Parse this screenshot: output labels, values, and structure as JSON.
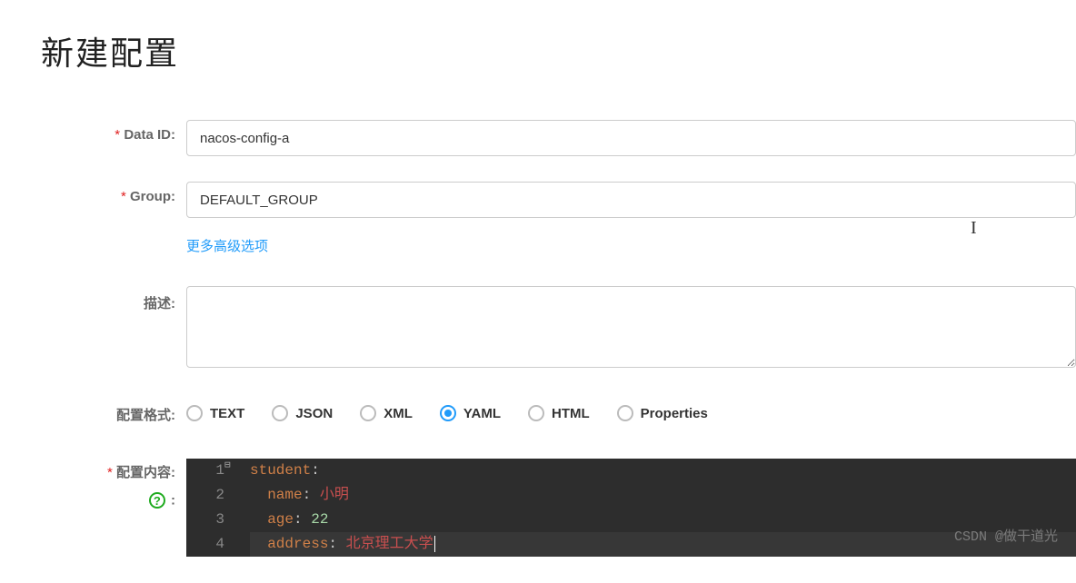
{
  "page": {
    "title": "新建配置"
  },
  "fields": {
    "dataId": {
      "label": "Data ID:",
      "value": "nacos-config-a"
    },
    "group": {
      "label": "Group:",
      "value": "DEFAULT_GROUP"
    },
    "advancedLink": "更多高级选项",
    "description": {
      "label": "描述:",
      "value": ""
    },
    "format": {
      "label": "配置格式:",
      "options": [
        "TEXT",
        "JSON",
        "XML",
        "YAML",
        "HTML",
        "Properties"
      ],
      "selected": "YAML"
    },
    "content": {
      "label": "配置内容:",
      "lines": [
        {
          "n": 1,
          "indent": 0,
          "key": "student",
          "value": "",
          "valueType": "none"
        },
        {
          "n": 2,
          "indent": 1,
          "key": "name",
          "value": "小明",
          "valueType": "string"
        },
        {
          "n": 3,
          "indent": 1,
          "key": "age",
          "value": "22",
          "valueType": "number"
        },
        {
          "n": 4,
          "indent": 1,
          "key": "address",
          "value": "北京理工大学",
          "valueType": "string"
        }
      ]
    }
  },
  "help": {
    "glyph": "?"
  },
  "watermark": "CSDN @做干道光"
}
